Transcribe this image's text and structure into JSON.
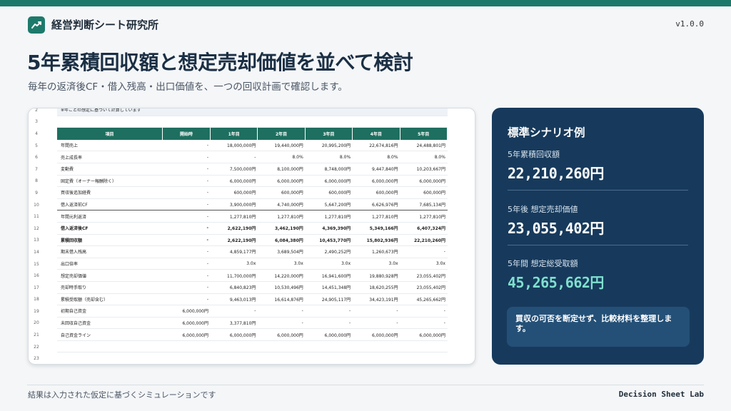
{
  "header": {
    "brand": "経営判断シート研究所",
    "version": "v1.0.0"
  },
  "main": {
    "title": "5年累積回収額と想定売却価値を並べて検討",
    "subtitle": "毎年の返済後CF・借入残高・出口価値を、一つの回収計画で確認します。"
  },
  "sheet": {
    "top_caption": "※年ごとの想定に基づいて計算しています",
    "columns": [
      "項目",
      "開始時",
      "1年目",
      "2年目",
      "3年目",
      "4年目",
      "5年目"
    ],
    "rows": [
      {
        "n": "5",
        "cells": [
          "年間売上",
          "-",
          "18,000,000円",
          "19,440,000円",
          "20,995,200円",
          "22,674,816円",
          "24,488,801円"
        ]
      },
      {
        "n": "6",
        "cells": [
          "売上成長率",
          "-",
          "-",
          "8.0%",
          "8.0%",
          "8.0%",
          "8.0%"
        ]
      },
      {
        "n": "7",
        "cells": [
          "変動費",
          "-",
          "7,500,000円",
          "8,100,000円",
          "8,748,000円",
          "9,447,840円",
          "10,203,667円"
        ]
      },
      {
        "n": "8",
        "cells": [
          "固定費（オーナー報酬除く）",
          "-",
          "6,000,000円",
          "6,000,000円",
          "6,000,000円",
          "6,000,000円",
          "6,000,000円"
        ]
      },
      {
        "n": "9",
        "cells": [
          "買収後追加経費",
          "-",
          "600,000円",
          "600,000円",
          "600,000円",
          "600,000円",
          "600,000円"
        ]
      },
      {
        "n": "10",
        "cells": [
          "借入返済前CF",
          "-",
          "3,900,000円",
          "4,740,000円",
          "5,647,200円",
          "6,626,976円",
          "7,685,134円"
        ],
        "thick": true
      },
      {
        "n": "11",
        "cells": [
          "年間元利返済",
          "-",
          "1,277,810円",
          "1,277,810円",
          "1,277,810円",
          "1,277,810円",
          "1,277,810円"
        ]
      },
      {
        "n": "12",
        "cells": [
          "借入返済後CF",
          "-",
          "2,622,190円",
          "3,462,190円",
          "4,369,390円",
          "5,349,166円",
          "6,407,324円"
        ],
        "bold": true
      },
      {
        "n": "13",
        "cells": [
          "累積回収額",
          "-",
          "2,622,190円",
          "6,084,380円",
          "10,453,770円",
          "15,802,936円",
          "22,210,260円"
        ],
        "bold": true
      },
      {
        "n": "14",
        "cells": [
          "期末借入残高",
          "-",
          "4,859,177円",
          "3,689,504円",
          "2,490,252円",
          "1,260,673円",
          "-"
        ]
      },
      {
        "n": "15",
        "cells": [
          "出口倍率",
          "-",
          "3.0x",
          "3.0x",
          "3.0x",
          "3.0x",
          "3.0x"
        ]
      },
      {
        "n": "16",
        "cells": [
          "想定売却価値",
          "-",
          "11,700,000円",
          "14,220,000円",
          "16,941,600円",
          "19,880,928円",
          "23,055,402円"
        ]
      },
      {
        "n": "17",
        "cells": [
          "売却時手取り",
          "-",
          "6,840,823円",
          "10,530,496円",
          "14,451,348円",
          "18,620,255円",
          "23,055,402円"
        ]
      },
      {
        "n": "18",
        "cells": [
          "累積受取額（売却含む）",
          "-",
          "9,463,013円",
          "16,614,876円",
          "24,905,117円",
          "34,423,191円",
          "45,265,662円"
        ]
      },
      {
        "n": "19",
        "cells": [
          "初期自己資金",
          "6,000,000円",
          "-",
          "-",
          "-",
          "-",
          "-"
        ]
      },
      {
        "n": "20",
        "cells": [
          "未回収自己資金",
          "6,000,000円",
          "3,377,810円",
          "-",
          "-",
          "-",
          "-"
        ]
      },
      {
        "n": "21",
        "cells": [
          "自己資金ライン",
          "6,000,000円",
          "6,000,000円",
          "6,000,000円",
          "6,000,000円",
          "6,000,000円",
          "6,000,000円"
        ]
      }
    ],
    "empty_rows": [
      "22",
      "23"
    ],
    "pre_rows": [
      "2",
      "3"
    ],
    "header_row_num": "4"
  },
  "panel": {
    "title": "標準シナリオ例",
    "m1_label": "5年累積回収額",
    "m1_value": "22,210,260円",
    "m2_label": "5年後  想定売却価値",
    "m2_value": "23,055,402円",
    "m3_label": "5年間  想定総受取額",
    "m3_value": "45,265,662円",
    "m3_color": "#7fe0cf",
    "note": "買収の可否を断定せず、比較材料を整理します。"
  },
  "footer": {
    "left": "結果は入力された仮定に基づくシミュレーションです",
    "right": "Decision Sheet Lab"
  },
  "colors": {
    "accent": "#1d7a6b",
    "panel": "#173a5c",
    "header": "#1e6f5f"
  }
}
